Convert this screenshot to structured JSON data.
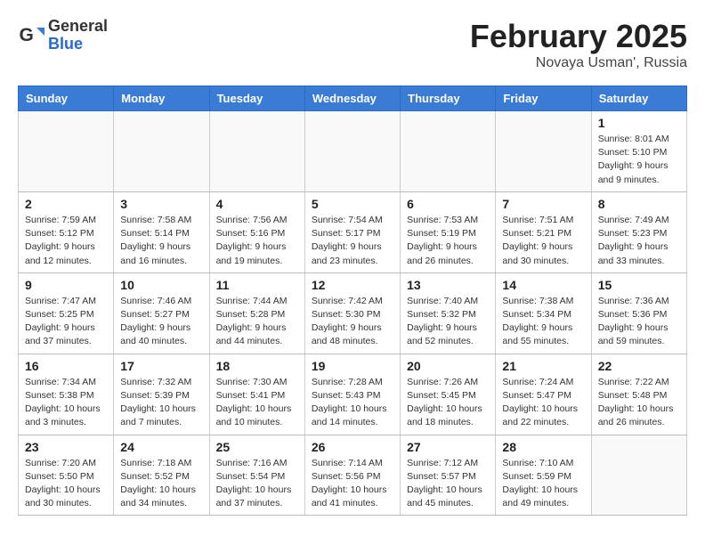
{
  "header": {
    "logo": {
      "general": "General",
      "blue": "Blue"
    },
    "title": "February 2025",
    "location": "Novaya Usman', Russia"
  },
  "weekdays": [
    "Sunday",
    "Monday",
    "Tuesday",
    "Wednesday",
    "Thursday",
    "Friday",
    "Saturday"
  ],
  "weeks": [
    [
      {
        "day": "",
        "info": ""
      },
      {
        "day": "",
        "info": ""
      },
      {
        "day": "",
        "info": ""
      },
      {
        "day": "",
        "info": ""
      },
      {
        "day": "",
        "info": ""
      },
      {
        "day": "",
        "info": ""
      },
      {
        "day": "1",
        "info": "Sunrise: 8:01 AM\nSunset: 5:10 PM\nDaylight: 9 hours\nand 9 minutes."
      }
    ],
    [
      {
        "day": "2",
        "info": "Sunrise: 7:59 AM\nSunset: 5:12 PM\nDaylight: 9 hours\nand 12 minutes."
      },
      {
        "day": "3",
        "info": "Sunrise: 7:58 AM\nSunset: 5:14 PM\nDaylight: 9 hours\nand 16 minutes."
      },
      {
        "day": "4",
        "info": "Sunrise: 7:56 AM\nSunset: 5:16 PM\nDaylight: 9 hours\nand 19 minutes."
      },
      {
        "day": "5",
        "info": "Sunrise: 7:54 AM\nSunset: 5:17 PM\nDaylight: 9 hours\nand 23 minutes."
      },
      {
        "day": "6",
        "info": "Sunrise: 7:53 AM\nSunset: 5:19 PM\nDaylight: 9 hours\nand 26 minutes."
      },
      {
        "day": "7",
        "info": "Sunrise: 7:51 AM\nSunset: 5:21 PM\nDaylight: 9 hours\nand 30 minutes."
      },
      {
        "day": "8",
        "info": "Sunrise: 7:49 AM\nSunset: 5:23 PM\nDaylight: 9 hours\nand 33 minutes."
      }
    ],
    [
      {
        "day": "9",
        "info": "Sunrise: 7:47 AM\nSunset: 5:25 PM\nDaylight: 9 hours\nand 37 minutes."
      },
      {
        "day": "10",
        "info": "Sunrise: 7:46 AM\nSunset: 5:27 PM\nDaylight: 9 hours\nand 40 minutes."
      },
      {
        "day": "11",
        "info": "Sunrise: 7:44 AM\nSunset: 5:28 PM\nDaylight: 9 hours\nand 44 minutes."
      },
      {
        "day": "12",
        "info": "Sunrise: 7:42 AM\nSunset: 5:30 PM\nDaylight: 9 hours\nand 48 minutes."
      },
      {
        "day": "13",
        "info": "Sunrise: 7:40 AM\nSunset: 5:32 PM\nDaylight: 9 hours\nand 52 minutes."
      },
      {
        "day": "14",
        "info": "Sunrise: 7:38 AM\nSunset: 5:34 PM\nDaylight: 9 hours\nand 55 minutes."
      },
      {
        "day": "15",
        "info": "Sunrise: 7:36 AM\nSunset: 5:36 PM\nDaylight: 9 hours\nand 59 minutes."
      }
    ],
    [
      {
        "day": "16",
        "info": "Sunrise: 7:34 AM\nSunset: 5:38 PM\nDaylight: 10 hours\nand 3 minutes."
      },
      {
        "day": "17",
        "info": "Sunrise: 7:32 AM\nSunset: 5:39 PM\nDaylight: 10 hours\nand 7 minutes."
      },
      {
        "day": "18",
        "info": "Sunrise: 7:30 AM\nSunset: 5:41 PM\nDaylight: 10 hours\nand 10 minutes."
      },
      {
        "day": "19",
        "info": "Sunrise: 7:28 AM\nSunset: 5:43 PM\nDaylight: 10 hours\nand 14 minutes."
      },
      {
        "day": "20",
        "info": "Sunrise: 7:26 AM\nSunset: 5:45 PM\nDaylight: 10 hours\nand 18 minutes."
      },
      {
        "day": "21",
        "info": "Sunrise: 7:24 AM\nSunset: 5:47 PM\nDaylight: 10 hours\nand 22 minutes."
      },
      {
        "day": "22",
        "info": "Sunrise: 7:22 AM\nSunset: 5:48 PM\nDaylight: 10 hours\nand 26 minutes."
      }
    ],
    [
      {
        "day": "23",
        "info": "Sunrise: 7:20 AM\nSunset: 5:50 PM\nDaylight: 10 hours\nand 30 minutes."
      },
      {
        "day": "24",
        "info": "Sunrise: 7:18 AM\nSunset: 5:52 PM\nDaylight: 10 hours\nand 34 minutes."
      },
      {
        "day": "25",
        "info": "Sunrise: 7:16 AM\nSunset: 5:54 PM\nDaylight: 10 hours\nand 37 minutes."
      },
      {
        "day": "26",
        "info": "Sunrise: 7:14 AM\nSunset: 5:56 PM\nDaylight: 10 hours\nand 41 minutes."
      },
      {
        "day": "27",
        "info": "Sunrise: 7:12 AM\nSunset: 5:57 PM\nDaylight: 10 hours\nand 45 minutes."
      },
      {
        "day": "28",
        "info": "Sunrise: 7:10 AM\nSunset: 5:59 PM\nDaylight: 10 hours\nand 49 minutes."
      },
      {
        "day": "",
        "info": ""
      }
    ]
  ]
}
